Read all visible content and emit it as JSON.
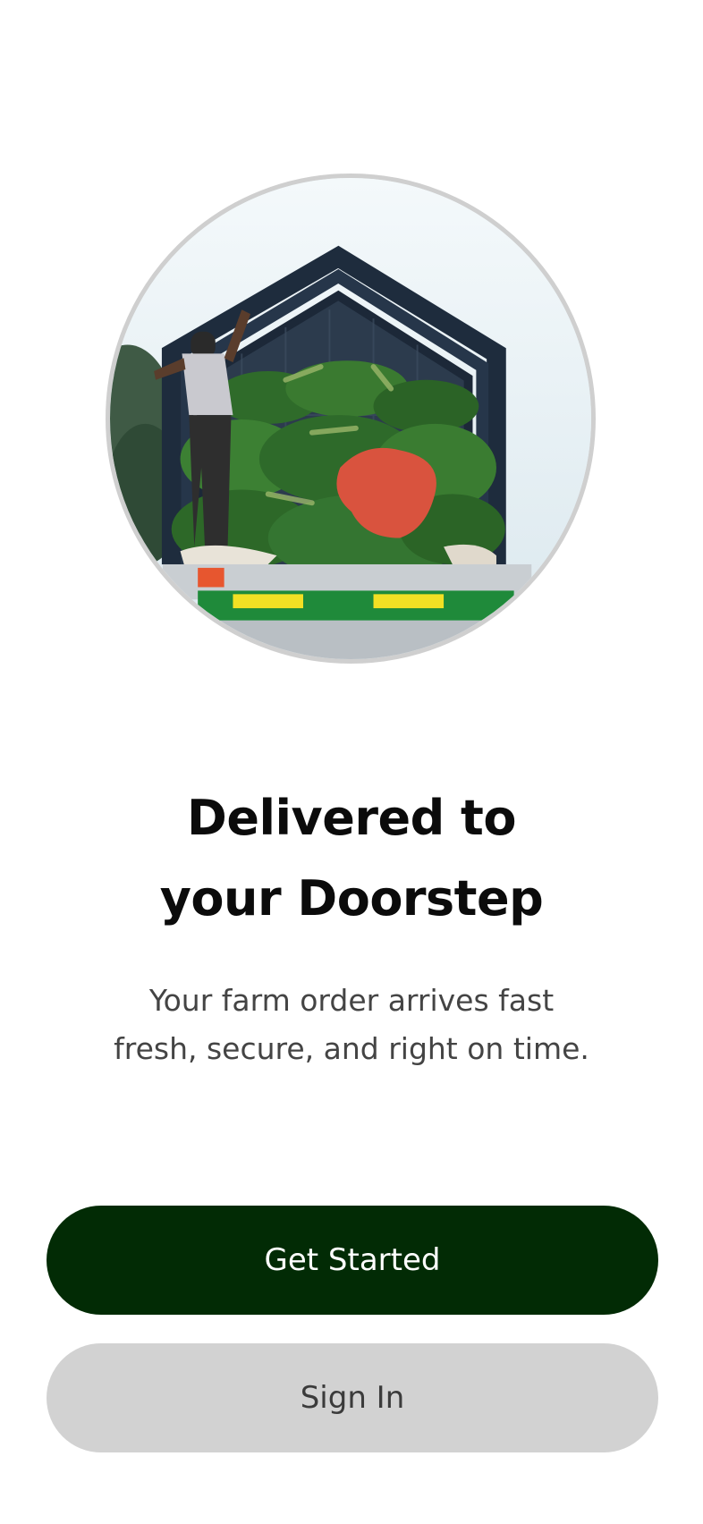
{
  "hero": {
    "image_alt": "Truck loaded with green bananas"
  },
  "onboarding": {
    "title_line1": "Delivered to",
    "title_line2": "your Doorstep",
    "subtitle_line1": "Your farm order arrives fast",
    "subtitle_line2": "fresh, secure, and right on time."
  },
  "actions": {
    "primary_label": "Get Started",
    "secondary_label": "Sign In"
  },
  "colors": {
    "primary": "#022b05",
    "secondary": "#d2d2d2",
    "ring": "#cfcfcf"
  }
}
